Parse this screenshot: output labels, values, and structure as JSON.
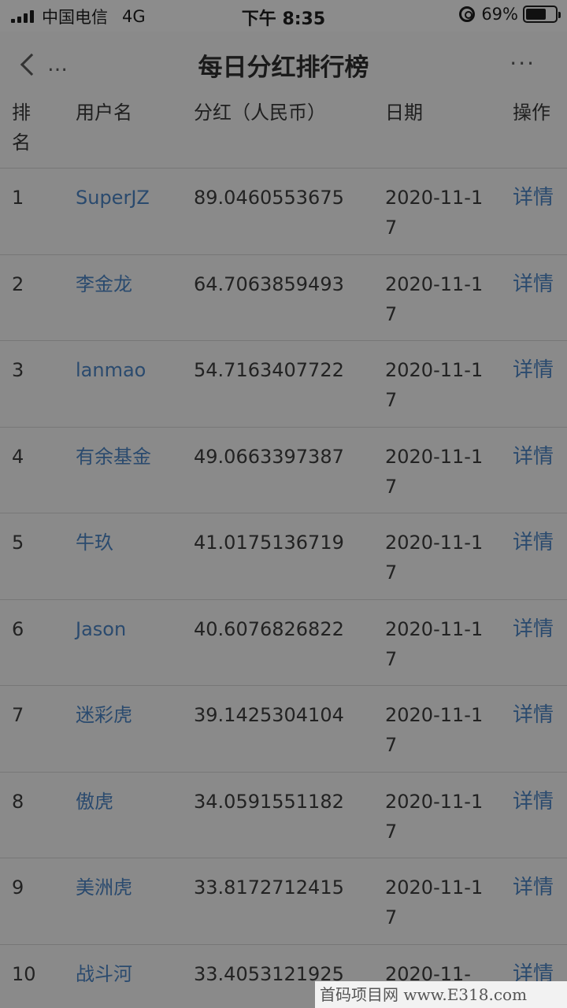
{
  "status_bar": {
    "carrier": "中国电信",
    "network": "4G",
    "time": "下午 8:35",
    "battery": "69%",
    "battery_level": 0.69
  },
  "nav": {
    "title": "每日分红排行榜",
    "back_icon": "chevron-left-icon",
    "back_dots": "…",
    "more_icon": "more-icon",
    "more_label": "···"
  },
  "table": {
    "headers": {
      "rank": "排名",
      "user": "用户名",
      "amount": "分红（人民币）",
      "date": "日期",
      "action": "操作"
    },
    "rows": [
      {
        "rank": "1",
        "user": "SuperJZ",
        "amount": "89.0460553675",
        "date": "2020-11-17",
        "action": "详情"
      },
      {
        "rank": "2",
        "user": "李金龙",
        "amount": "64.7063859493",
        "date": "2020-11-17",
        "action": "详情"
      },
      {
        "rank": "3",
        "user": "lanmao",
        "amount": "54.7163407722",
        "date": "2020-11-17",
        "action": "详情"
      },
      {
        "rank": "4",
        "user": "有余基金",
        "amount": "49.0663397387",
        "date": "2020-11-17",
        "action": "详情"
      },
      {
        "rank": "5",
        "user": "牛玖",
        "amount": "41.0175136719",
        "date": "2020-11-17",
        "action": "详情"
      },
      {
        "rank": "6",
        "user": "Jason",
        "amount": "40.6076826822",
        "date": "2020-11-17",
        "action": "详情"
      },
      {
        "rank": "7",
        "user": "迷彩虎",
        "amount": "39.1425304104",
        "date": "2020-11-17",
        "action": "详情"
      },
      {
        "rank": "8",
        "user": "傲虎",
        "amount": "34.0591551182",
        "date": "2020-11-17",
        "action": "详情"
      },
      {
        "rank": "9",
        "user": "美洲虎",
        "amount": "33.8172712415",
        "date": "2020-11-17",
        "action": "详情"
      },
      {
        "rank": "10",
        "user": "战斗河",
        "amount": "33.4053121925",
        "date": "2020-11-",
        "action": "详情"
      }
    ]
  },
  "watermark": "首码项目网 www.E318.com"
}
